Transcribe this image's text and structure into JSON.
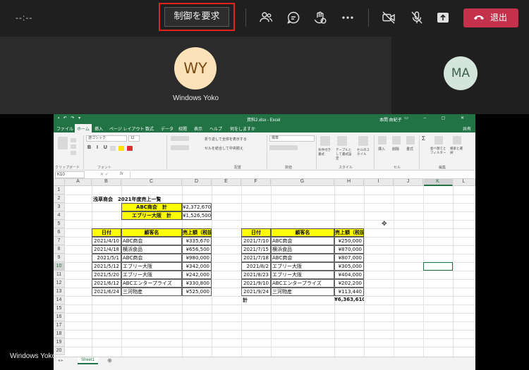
{
  "meeting": {
    "timer": "--:--",
    "request_control": "制御を要求",
    "leave": "退出",
    "presenter_name": "Windows Yoko",
    "colors": {
      "leave": "#c4314b",
      "highlight": "#e1251b",
      "avatar_wy": "#fbe2b8",
      "avatar_ma": "#d4e6dc"
    },
    "toolbar_icons": [
      "people-icon",
      "chat-icon",
      "reaction-icon",
      "more-icon",
      "camera-off-icon",
      "mic-off-icon",
      "share-icon"
    ]
  },
  "participants": [
    {
      "initials": "WY",
      "name": "Windows Yoko"
    },
    {
      "initials": "MA"
    }
  ],
  "excel": {
    "filename": "資料2.xlsx - Excel",
    "user": "本間 由紀子",
    "tabs": [
      "ファイル",
      "ホーム",
      "挿入",
      "ページ レイアウト",
      "数式",
      "データ",
      "校閲",
      "表示",
      "ヘルプ",
      "何をしますか"
    ],
    "active_tab": "ホーム",
    "share_label": "共有",
    "ribbon": {
      "font_name": "游ゴシック",
      "font_size": "12",
      "wrap_text": "折り返して全体を表示する",
      "merge_center": "セルを結合して中央揃え",
      "number_format": "標準",
      "group_labels": [
        "クリップボード",
        "フォント",
        "配置",
        "数値",
        "スタイル",
        "セル",
        "編集"
      ],
      "styles": [
        "条件付き書式",
        "テーブルとして書式設定",
        "セルのスタイル"
      ],
      "cells": [
        "挿入",
        "削除",
        "書式"
      ],
      "editing": [
        "並べ替えとフィルター",
        "検索と選択"
      ]
    },
    "name_box": "K10",
    "columns": [
      "A",
      "B",
      "C",
      "D",
      "E",
      "F",
      "G",
      "H",
      "I",
      "J",
      "K",
      "L"
    ],
    "rows": [
      "1",
      "2",
      "3",
      "4",
      "5",
      "6",
      "7",
      "8",
      "9",
      "10",
      "11",
      "12",
      "13",
      "14",
      "15",
      "16",
      "17",
      "18",
      "19",
      "20"
    ],
    "title": "浅草商会　2021年度売上一覧",
    "summary": [
      {
        "label": "ABC商会　計",
        "value": "¥2,372,670"
      },
      {
        "label": "エブリー大阪　計",
        "value": "¥1,526,500"
      }
    ],
    "headers": [
      "日付",
      "顧客名",
      "売上額（税抜）"
    ],
    "table1": [
      [
        "2021/4/10",
        "ABC商会",
        "¥335,670"
      ],
      [
        "2021/4/18",
        "横浜食品",
        "¥656,500"
      ],
      [
        "2021/5/1",
        "ABC商会",
        "¥980,000"
      ],
      [
        "2021/5/12",
        "エブリー大阪",
        "¥342,000"
      ],
      [
        "2021/5/20",
        "エブリー大阪",
        "¥242,000"
      ],
      [
        "2021/6/12",
        "ABCエンタープライズ",
        "¥330,800"
      ],
      [
        "2021/6/24",
        "三河物産",
        "¥525,000"
      ]
    ],
    "table2": [
      [
        "2021/7/10",
        "ABC商会",
        "¥250,000"
      ],
      [
        "2021/7/15",
        "横浜食品",
        "¥870,000"
      ],
      [
        "2021/7/18",
        "ABC商会",
        "¥807,000"
      ],
      [
        "2021/8/2",
        "エブリー大阪",
        "¥305,000"
      ],
      [
        "2021/8/23",
        "エブリー大阪",
        "¥404,000"
      ],
      [
        "2021/9/10",
        "ABCエンタープライズ",
        "¥202,200"
      ],
      [
        "2021/9/24",
        "三河物産",
        "¥113,440"
      ]
    ],
    "total_label": "計",
    "total_value": "¥6,363,610",
    "sheet_tab": "Sheet1"
  }
}
